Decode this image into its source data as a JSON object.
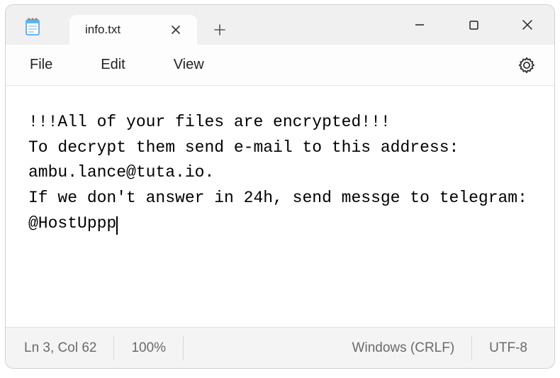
{
  "app": {
    "title": "Notepad"
  },
  "tab": {
    "title": "info.txt"
  },
  "menu": {
    "file": "File",
    "edit": "Edit",
    "view": "View"
  },
  "document": {
    "content": "!!!All of your files are encrypted!!!\nTo decrypt them send e-mail to this address: ambu.lance@tuta.io.\nIf we don't answer in 24h, send messge to telegram: @HostUppp"
  },
  "status": {
    "cursor": "Ln 3, Col 62",
    "zoom": "100%",
    "eol": "Windows (CRLF)",
    "encoding": "UTF-8"
  }
}
